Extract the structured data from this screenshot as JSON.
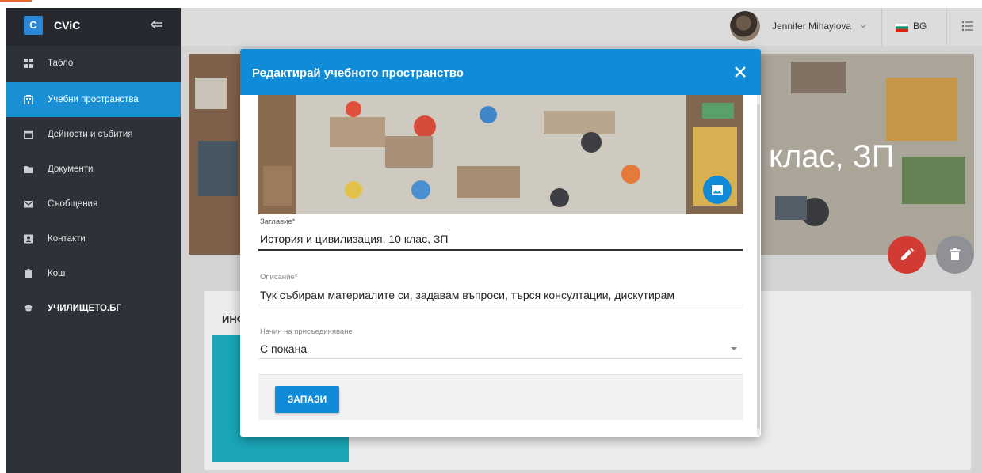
{
  "app": {
    "logo_letter": "C",
    "name": "CViC"
  },
  "colors": {
    "sidebar_bg": "#2d3138",
    "accent": "#0f8bd8",
    "active_nav": "#1a8fd4",
    "danger": "#d23a34",
    "teal": "#1aa6b7"
  },
  "sidebar": {
    "items": [
      {
        "label": "Табло",
        "icon": "dashboard-icon",
        "active": false
      },
      {
        "label": "Учебни пространства",
        "icon": "building-icon",
        "active": true
      },
      {
        "label": "Дейности и събития",
        "icon": "calendar-icon",
        "active": false
      },
      {
        "label": "Документи",
        "icon": "folder-icon",
        "active": false
      },
      {
        "label": "Съобщения",
        "icon": "envelope-icon",
        "active": false
      },
      {
        "label": "Контакти",
        "icon": "contact-card-icon",
        "active": false
      },
      {
        "label": "Кош",
        "icon": "trash-icon",
        "active": false
      },
      {
        "label": "УЧИЛИЩЕТО.БГ",
        "icon": "graduation-cap-icon",
        "active": false
      }
    ]
  },
  "header": {
    "user_name": "Jennifer Mihaylova",
    "language": "BG"
  },
  "page": {
    "hero_title": "клас, ЗП",
    "tab_label": "ИНФ"
  },
  "dialog": {
    "title": "Редактирай учебното пространство",
    "fields": {
      "title_label": "Заглавие",
      "title_value": "История и цивилизация, 10 клас, ЗП",
      "description_label": "Описание",
      "description_value": "Тук събирам материалите си, задавам въпроси, търся консултации, дискутирам",
      "join_label": "Начин на присъединяване",
      "join_value": "С покана"
    },
    "required_mark": "*",
    "save_label": "ЗАПАЗИ"
  }
}
